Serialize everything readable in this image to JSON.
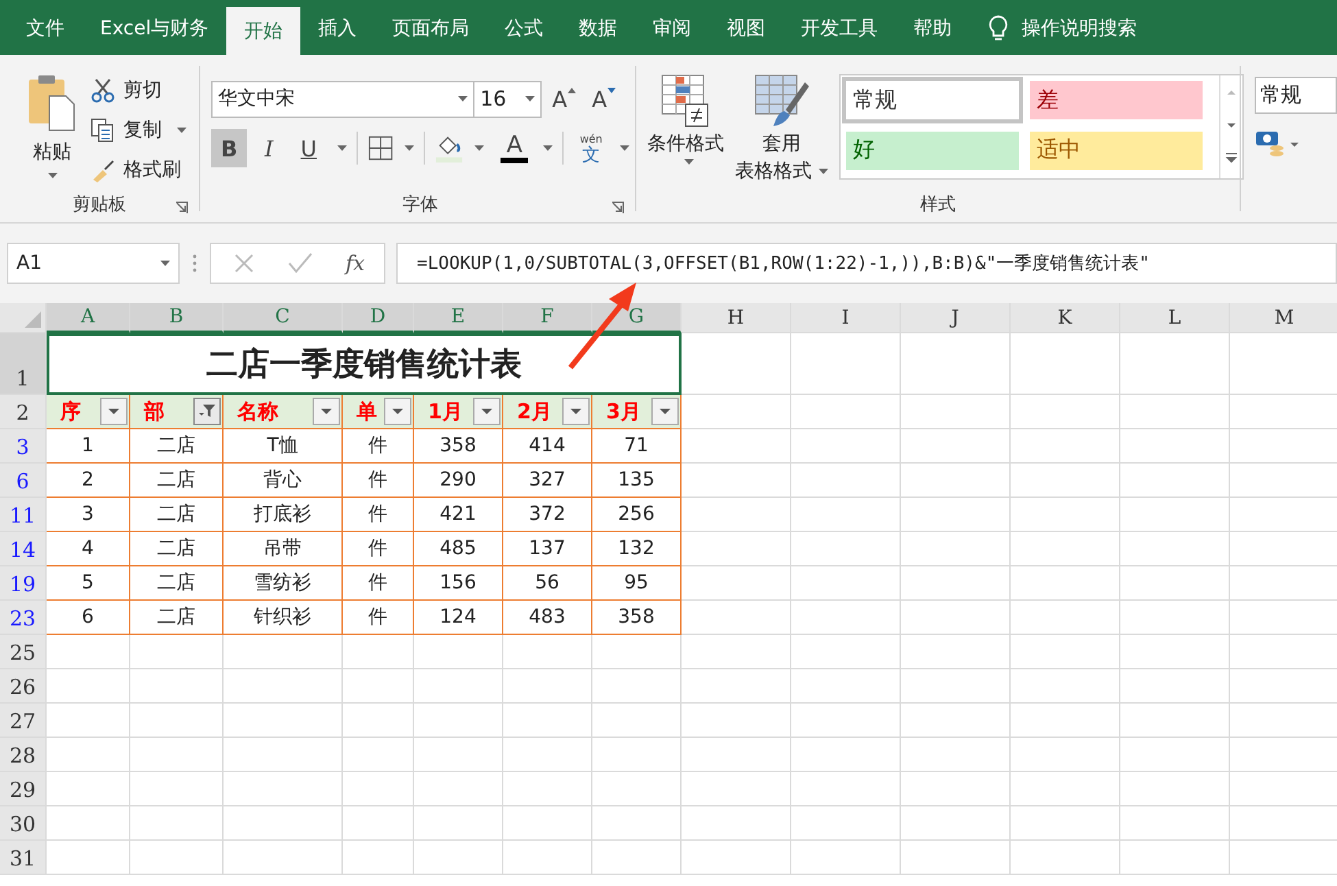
{
  "tabs": [
    {
      "label": "文件",
      "selected": false
    },
    {
      "label": "Excel与财务",
      "selected": false
    },
    {
      "label": "开始",
      "selected": true
    },
    {
      "label": "插入",
      "selected": false
    },
    {
      "label": "页面布局",
      "selected": false
    },
    {
      "label": "公式",
      "selected": false
    },
    {
      "label": "数据",
      "selected": false
    },
    {
      "label": "审阅",
      "selected": false
    },
    {
      "label": "视图",
      "selected": false
    },
    {
      "label": "开发工具",
      "selected": false
    },
    {
      "label": "帮助",
      "selected": false
    }
  ],
  "tell_me": "操作说明搜索",
  "clipboard": {
    "paste": "粘贴",
    "cut": "剪切",
    "copy": "复制",
    "format_painter": "格式刷",
    "group_label": "剪贴板"
  },
  "font": {
    "name": "华文中宋",
    "size": "16",
    "grow": "A",
    "shrink": "A",
    "bold_label": "B",
    "italic_label": "I",
    "underline_label": "U",
    "bold": true,
    "italic": false,
    "underline": false,
    "font_color_label": "A",
    "phonetic_top": "wén",
    "phonetic_bottom": "文",
    "group_label": "字体"
  },
  "styles": {
    "conditional": "条件格式",
    "table_line1": "套用",
    "table_line2": "表格格式",
    "group_label": "样式",
    "cells": [
      {
        "label": "常规",
        "selected": true,
        "color": "#ffffff"
      },
      {
        "label": "差",
        "selected": false,
        "color": "#ffc7ce"
      },
      {
        "label": "好",
        "selected": false,
        "color": "#c6efce"
      },
      {
        "label": "适中",
        "selected": false,
        "color": "#ffeb9c"
      }
    ]
  },
  "number": {
    "format": "常规"
  },
  "formula_bar": {
    "name_box": "A1",
    "fx": "fx",
    "formula": "=LOOKUP(1,0/SUBTOTAL(3,OFFSET(B1,ROW(1:22)-1,)),B:B)&\"一季度销售统计表\""
  },
  "sheet": {
    "columns": [
      {
        "letter": "A",
        "selected": true
      },
      {
        "letter": "B",
        "selected": true
      },
      {
        "letter": "C",
        "selected": true
      },
      {
        "letter": "D",
        "selected": true
      },
      {
        "letter": "E",
        "selected": true
      },
      {
        "letter": "F",
        "selected": true
      },
      {
        "letter": "G",
        "selected": true
      },
      {
        "letter": "H",
        "selected": false
      },
      {
        "letter": "I",
        "selected": false
      },
      {
        "letter": "J",
        "selected": false
      },
      {
        "letter": "K",
        "selected": false
      },
      {
        "letter": "L",
        "selected": false
      },
      {
        "letter": "M",
        "selected": false
      }
    ],
    "title_row": {
      "number": "1",
      "selected": true
    },
    "title": "二店一季度销售统计表",
    "header_row": {
      "number": "2",
      "selected": false
    },
    "headers": [
      {
        "label": "序",
        "filter_active": false
      },
      {
        "label": "部",
        "filter_active": true
      },
      {
        "label": "名称",
        "filter_active": false
      },
      {
        "label": "单",
        "filter_active": false
      },
      {
        "label": "1月",
        "filter_active": false
      },
      {
        "label": "2月",
        "filter_active": false
      },
      {
        "label": "3月",
        "filter_active": false
      }
    ],
    "rows": [
      {
        "number": "3",
        "filtered": true,
        "cells": [
          "1",
          "二店",
          "T恤",
          "件",
          "358",
          "414",
          "71"
        ]
      },
      {
        "number": "6",
        "filtered": true,
        "cells": [
          "2",
          "二店",
          "背心",
          "件",
          "290",
          "327",
          "135"
        ]
      },
      {
        "number": "11",
        "filtered": true,
        "cells": [
          "3",
          "二店",
          "打底衫",
          "件",
          "421",
          "372",
          "256"
        ]
      },
      {
        "number": "14",
        "filtered": true,
        "cells": [
          "4",
          "二店",
          "吊带",
          "件",
          "485",
          "137",
          "132"
        ]
      },
      {
        "number": "19",
        "filtered": true,
        "cells": [
          "5",
          "二店",
          "雪纺衫",
          "件",
          "156",
          "56",
          "95"
        ]
      },
      {
        "number": "23",
        "filtered": true,
        "cells": [
          "6",
          "二店",
          "针织衫",
          "件",
          "124",
          "483",
          "358"
        ]
      }
    ],
    "empty_rows": [
      {
        "number": "25",
        "filtered": false
      },
      {
        "number": "26",
        "filtered": false
      },
      {
        "number": "27",
        "filtered": false
      },
      {
        "number": "28",
        "filtered": false
      },
      {
        "number": "29",
        "filtered": false
      },
      {
        "number": "30",
        "filtered": false
      },
      {
        "number": "31",
        "filtered": false
      }
    ]
  }
}
